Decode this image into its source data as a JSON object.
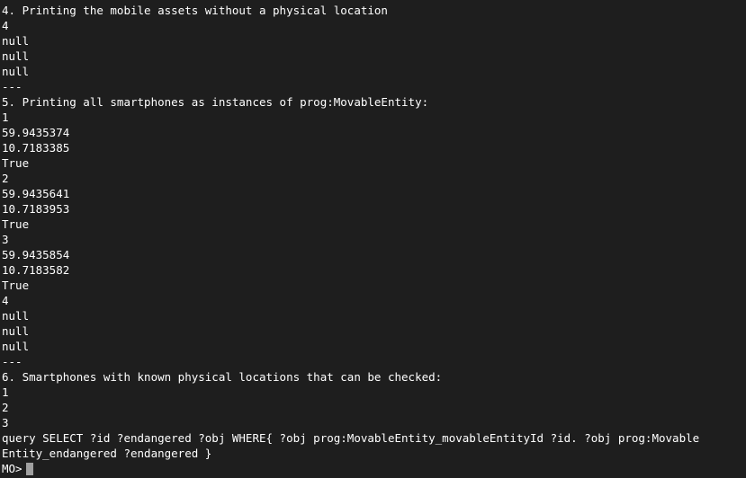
{
  "terminal": {
    "lines": [
      "4. Printing the mobile assets without a physical location",
      "4",
      "null",
      "null",
      "null",
      "---",
      "5. Printing all smartphones as instances of prog:MovableEntity:",
      "1",
      "59.9435374",
      "10.7183385",
      "True",
      "2",
      "59.9435641",
      "10.7183953",
      "True",
      "3",
      "59.9435854",
      "10.7183582",
      "True",
      "4",
      "null",
      "null",
      "null",
      "---",
      "6. Smartphones with known physical locations that can be checked:",
      "1",
      "2",
      "3",
      "query SELECT ?id ?endangered ?obj WHERE{ ?obj prog:MovableEntity_movableEntityId ?id. ?obj prog:Movable",
      "Entity_endangered ?endangered }"
    ],
    "prompt": "MO>"
  }
}
